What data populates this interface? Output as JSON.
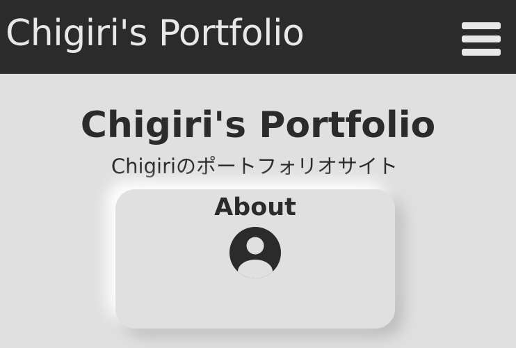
{
  "header": {
    "title": "Chigiri's Portfolio",
    "menu_icon": "hamburger-menu-icon"
  },
  "main": {
    "title": "Chigiri's Portfolio",
    "subtitle": "Chigiriのポートフォリオサイト"
  },
  "cards": [
    {
      "label": "About",
      "icon": "user-account-icon"
    }
  ],
  "colors": {
    "header_background": "#2b2b2b",
    "header_text": "#e8e8e8",
    "page_background": "#e0e0e0",
    "text": "#2b2b2b"
  }
}
